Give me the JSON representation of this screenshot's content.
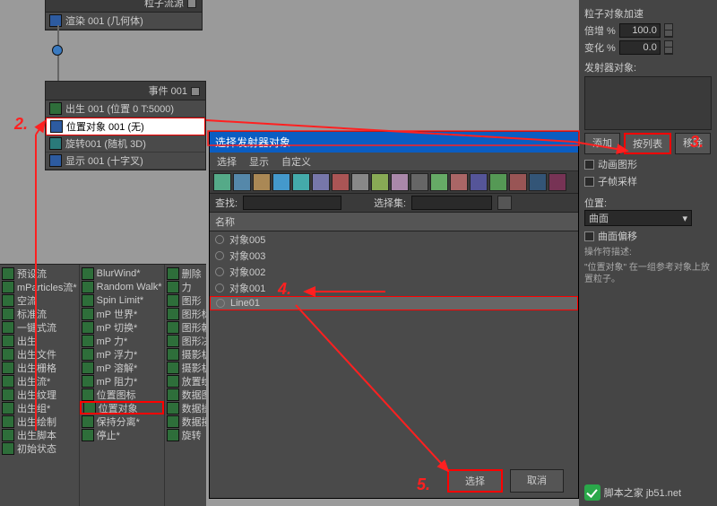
{
  "source_node": {
    "title": "粒子流源",
    "render": "渲染 001 (几何体)"
  },
  "event_node": {
    "title": "事件 001",
    "rows": [
      {
        "label": "出生 001 (位置 0 T:5000)",
        "icon": "green"
      },
      {
        "label": "位置对象 001 (无)",
        "icon": "blue",
        "selected": true
      },
      {
        "label": "旋转001 (随机 3D)",
        "icon": "teal"
      },
      {
        "label": "显示 001 (十字叉)",
        "icon": "blue"
      }
    ]
  },
  "ops": {
    "col1": [
      "预设流",
      "mParticles流*",
      "空流",
      "标准流",
      "一键式流",
      "出生",
      "出生文件",
      "出生栅格",
      "出生流*",
      "出生纹理",
      "出生组*",
      "出生绘制",
      "出生脚本",
      "初始状态"
    ],
    "col2": [
      "BlurWind*",
      "Random Walk*",
      "Spin Limit*",
      "mP 世界*",
      "mP 切换*",
      "mP 力*",
      "mP 浮力*",
      "mP 溶解*",
      "mP 阻力*",
      "位置图标",
      "位置对象",
      "保持分离*",
      "停止*"
    ],
    "col3": [
      "删除",
      "力",
      "图形",
      "图形标",
      "图形朝",
      "图形决",
      "摄影机",
      "摄影机",
      "放置绘",
      "数据图",
      "数据操",
      "数据损",
      "旋转"
    ]
  },
  "dialog": {
    "title": "选择发射器对象",
    "menu": [
      "选择",
      "显示",
      "自定义"
    ],
    "search_label": "查找:",
    "selset_label": "选择集:",
    "list_header": "名称",
    "items": [
      "对象005",
      "对象003",
      "对象002",
      "对象001",
      "Line01"
    ],
    "ok": "选择",
    "cancel": "取消"
  },
  "rpanel": {
    "header": "粒子对象加速",
    "doubling": "倍增 %",
    "variation": "变化 %",
    "dval": "100.0",
    "vval": "0.0",
    "emitter_label": "发射器对象:",
    "add": "添加",
    "bylist": "按列表",
    "remove": "移除",
    "anim_shape": "动画图形",
    "subframe": "子帧采样",
    "pos_label": "位置:",
    "pos_value": "曲面",
    "surf_offset": "曲面偏移",
    "desc_label": "操作符描述:",
    "desc": "\"位置对象\" 在一组参考对象上放置粒子。"
  },
  "annotations": {
    "a2": "2.",
    "a3": "3.",
    "a4": "4.",
    "a5": "5."
  },
  "watermark": "脚本之家  jb51.net"
}
